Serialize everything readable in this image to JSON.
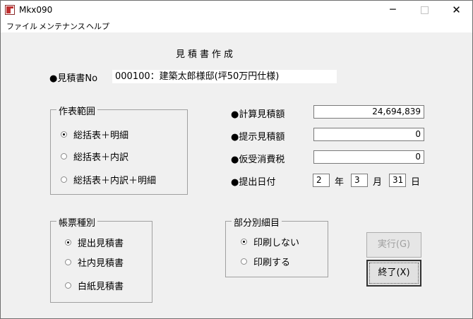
{
  "window": {
    "title": "Mkx090",
    "minimize": "─",
    "maximize": "□",
    "close": "✕"
  },
  "menu": [
    "ファイル",
    "メンテナンス",
    "ヘルプ"
  ],
  "form": {
    "title": "見積書作成",
    "estimate_no_label": "●見積書No",
    "estimate_no_value": "000100：建築太郎様邸(坪50万円仕様)"
  },
  "table_range": {
    "legend": "作表範囲",
    "options": [
      "総括表＋明細",
      "総括表＋内訳",
      "総括表＋内訳＋明細"
    ],
    "selected": 0
  },
  "amounts": {
    "calc_label": "●計算見積額",
    "calc_value": "24,694,839",
    "shown_label": "●提示見積額",
    "shown_value": "0",
    "tax_label": "●仮受消費税",
    "tax_value": "0",
    "date_label": "●提出日付",
    "year_value": "2",
    "year_unit": "年",
    "month_value": "3",
    "month_unit": "月",
    "day_value": "31",
    "day_unit": "日"
  },
  "form_type": {
    "legend": "帳票種別",
    "options": [
      "提出見積書",
      "社内見積書",
      "白紙見積書"
    ],
    "selected": 0
  },
  "detail": {
    "legend": "部分別細目",
    "options": [
      "印刷しない",
      "印刷する"
    ],
    "selected": 0
  },
  "buttons": {
    "run": "実行(G)",
    "exit": "終了(X)"
  }
}
